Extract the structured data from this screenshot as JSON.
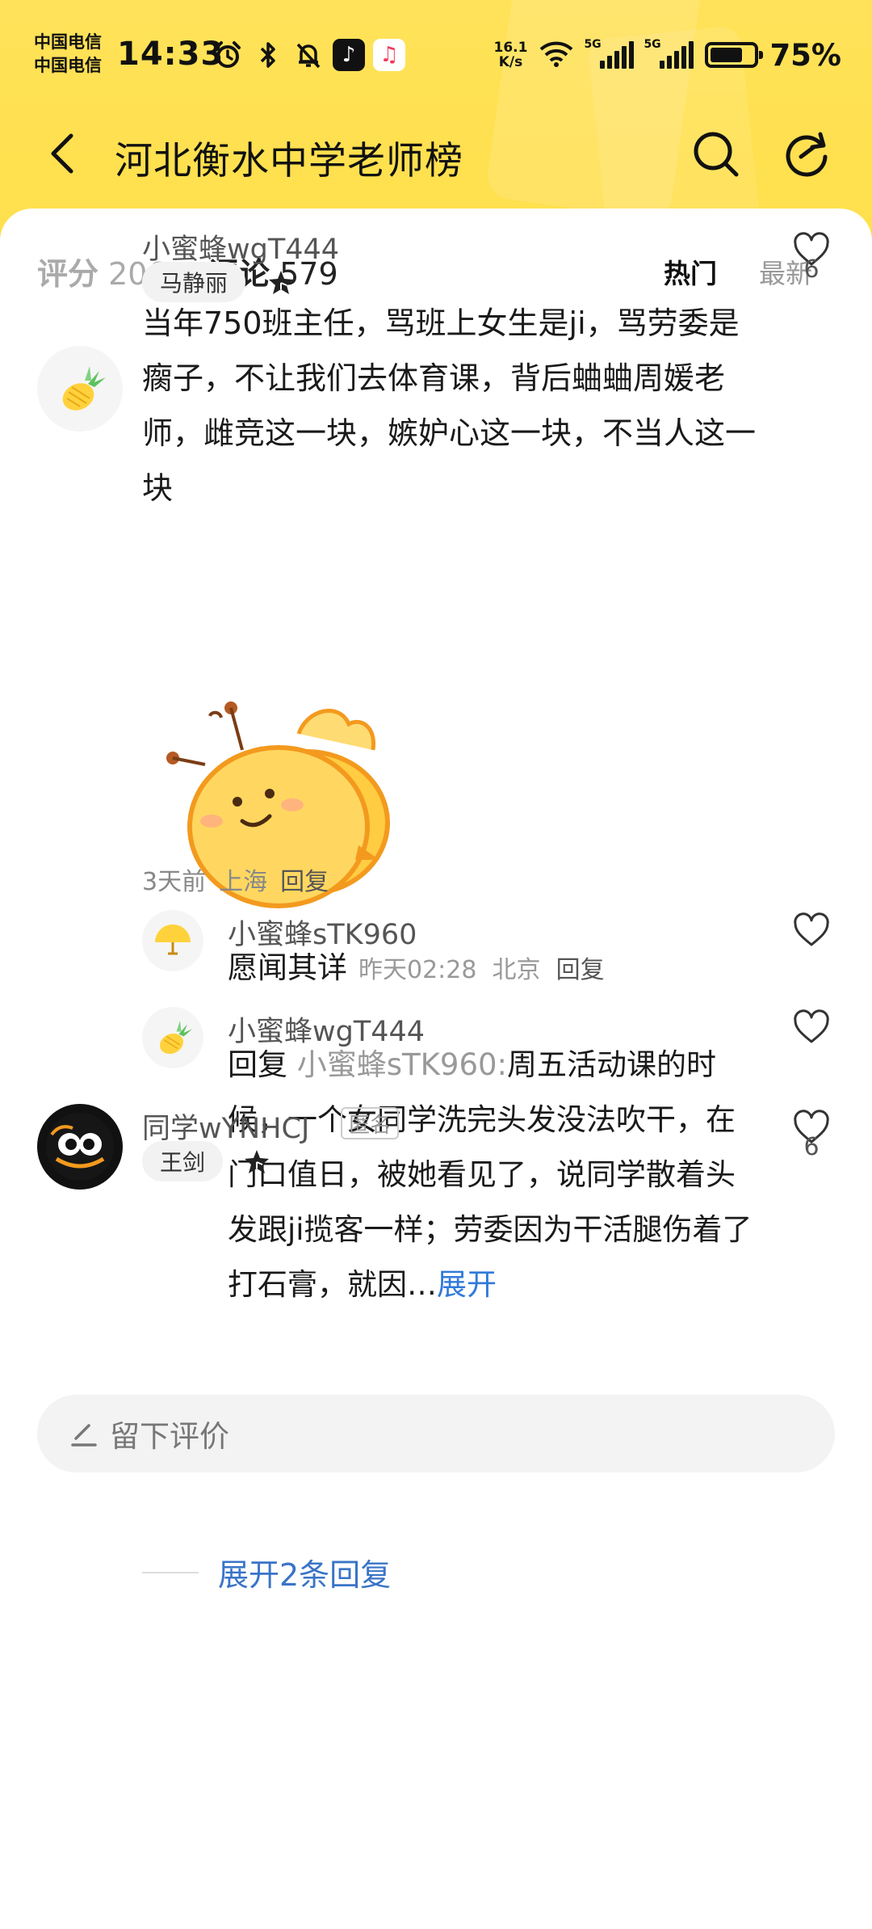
{
  "status_bar": {
    "carrier1": "中国电信",
    "carrier2": "中国电信",
    "time": "14:33",
    "net_speed_top": "16.1",
    "net_speed_bottom": "K/s",
    "signal1": "5G",
    "signal2": "5G",
    "battery": "75%",
    "battery_level": 0.75,
    "icons": [
      "alarm-icon",
      "bluetooth-icon",
      "mute-bell-icon",
      "tiktok-icon",
      "music-icon",
      "wifi-icon"
    ]
  },
  "nav": {
    "title": "河北衡水中学老师榜"
  },
  "stats": {
    "rating_label": "评分",
    "rating_value": "206",
    "comments_label": "评论",
    "comments_value": "579",
    "sort_hot": "热门",
    "sort_new": "最新"
  },
  "comments": [
    {
      "username": "小蜜蜂wgT444",
      "teacher": "马静丽",
      "text": "当年750班主任，骂班上女生是ji，骂劳委是瘸子，不让我们去体育课，背后蛐蛐周媛老师，雌竞这一块，嫉妒心这一块，不当人这一块",
      "likes": "6",
      "time": "3天前",
      "location": "上海",
      "reply_label": "回复",
      "replies": [
        {
          "username": "小蜜蜂sTK960",
          "text": "愿闻其详",
          "time": "昨天02:28",
          "location": "北京",
          "reply_label": "回复"
        },
        {
          "username": "小蜜蜂wgT444",
          "prefix": "回复",
          "mention": "小蜜蜂sTK960:",
          "text": "周五活动课的时候，一个女同学洗完头发没法吹干，在门口值日，被她看见了，说同学散着头发跟ji揽客一样；劳委因为干活腿伤着了打石膏，就因…",
          "expand": "展开"
        }
      ],
      "expand_replies": "展开2条回复"
    },
    {
      "username": "同学wYNHCJ",
      "anon_tag": "匿名",
      "teacher": "王剑",
      "likes": "6"
    }
  ],
  "footer": {
    "write_review": "留下评价"
  },
  "colors": {
    "header": "#ffe25a",
    "link": "#3a74c7"
  }
}
